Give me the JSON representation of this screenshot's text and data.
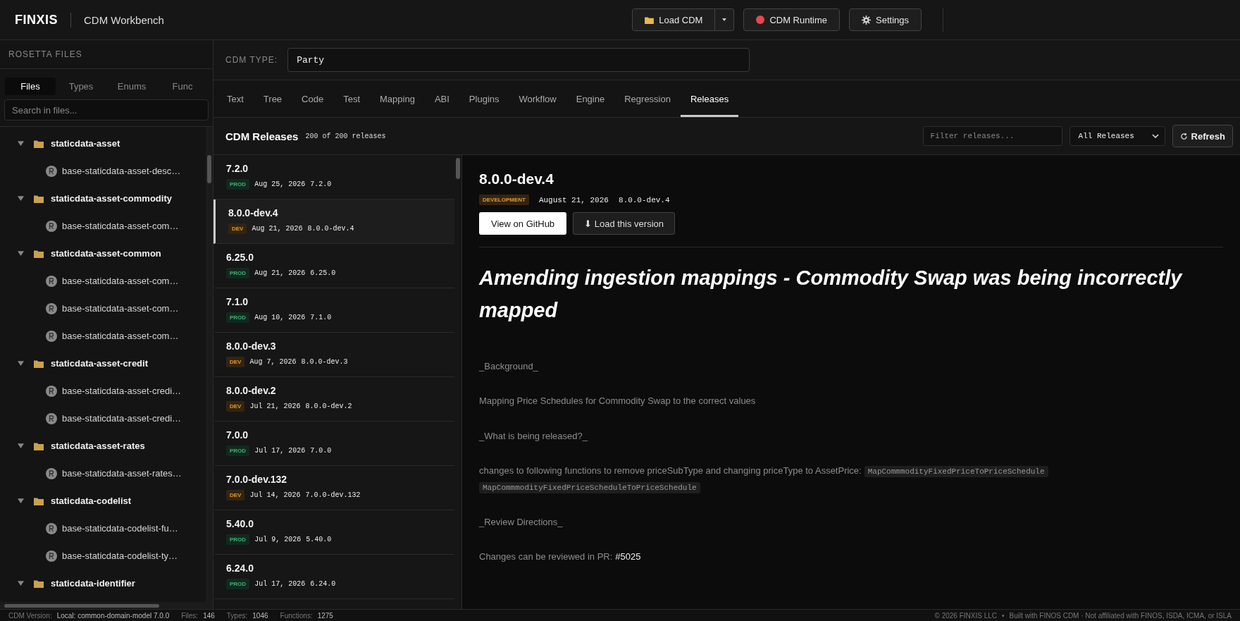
{
  "header": {
    "logo": "FINXIS",
    "app_title": "CDM Workbench",
    "buttons": [
      {
        "kind": "load",
        "label": "Load CDM"
      },
      {
        "kind": "runtime",
        "label": "CDM Runtime",
        "color": "#e5484d"
      },
      {
        "kind": "settings",
        "label": "Settings"
      }
    ]
  },
  "sidebar": {
    "title": "ROSETTA FILES",
    "tabs": [
      {
        "label": "Files",
        "selected": true
      },
      {
        "label": "Types",
        "selected": false
      },
      {
        "label": "Enums",
        "selected": false
      },
      {
        "label": "Func",
        "selected": false
      }
    ],
    "search": {
      "placeholder": "Search in files..."
    },
    "tree": [
      {
        "name": "staticdata-asset",
        "expanded": true,
        "children": [
          {
            "name": "base-staticdata-asset-desc…"
          }
        ]
      },
      {
        "name": "staticdata-asset-commodity",
        "expanded": true,
        "children": [
          {
            "name": "base-staticdata-asset-com…"
          }
        ]
      },
      {
        "name": "staticdata-asset-common",
        "expanded": true,
        "children": [
          {
            "name": "base-staticdata-asset-com…"
          },
          {
            "name": "base-staticdata-asset-com…"
          },
          {
            "name": "base-staticdata-asset-com…"
          }
        ]
      },
      {
        "name": "staticdata-asset-credit",
        "expanded": true,
        "children": [
          {
            "name": "base-staticdata-asset-credi…"
          },
          {
            "name": "base-staticdata-asset-credi…"
          }
        ]
      },
      {
        "name": "staticdata-asset-rates",
        "expanded": true,
        "children": [
          {
            "name": "base-staticdata-asset-rates…"
          }
        ]
      },
      {
        "name": "staticdata-codelist",
        "expanded": true,
        "children": [
          {
            "name": "base-staticdata-codelist-fu…"
          },
          {
            "name": "base-staticdata-codelist-ty…"
          }
        ]
      },
      {
        "name": "staticdata-identifier",
        "expanded": true
      }
    ]
  },
  "type_bar": {
    "label": "CDM TYPE:",
    "value": "Party"
  },
  "tabs": [
    {
      "label": "Text",
      "selected": false
    },
    {
      "label": "Tree",
      "selected": false
    },
    {
      "label": "Code",
      "selected": false
    },
    {
      "label": "Test",
      "selected": false
    },
    {
      "label": "Mapping",
      "selected": false
    },
    {
      "label": "ABI",
      "selected": false
    },
    {
      "label": "Plugins",
      "selected": false
    },
    {
      "label": "Workflow",
      "selected": false
    },
    {
      "label": "Engine",
      "selected": false
    },
    {
      "label": "Regression",
      "selected": false
    },
    {
      "label": "Releases",
      "selected": true
    }
  ],
  "releases": {
    "title": "CDM Releases",
    "count": "200 of 200 releases",
    "filter": {
      "placeholder": "Filter releases..."
    },
    "select": "All Releases",
    "refresh": "Refresh",
    "items": [
      {
        "version": "7.2.0",
        "kind": "prod",
        "badge": "PROD",
        "date": "Aug 25, 2026",
        "tag": "7.2.0",
        "selected": false
      },
      {
        "version": "8.0.0-dev.4",
        "kind": "dev",
        "badge": "DEV",
        "date": "Aug 21, 2026",
        "tag": "8.0.0-dev.4",
        "selected": true
      },
      {
        "version": "6.25.0",
        "kind": "prod",
        "badge": "PROD",
        "date": "Aug 21, 2026",
        "tag": "6.25.0",
        "selected": false
      },
      {
        "version": "7.1.0",
        "kind": "prod",
        "badge": "PROD",
        "date": "Aug 10, 2026",
        "tag": "7.1.0",
        "selected": false
      },
      {
        "version": "8.0.0-dev.3",
        "kind": "dev",
        "badge": "DEV",
        "date": "Aug 7, 2026",
        "tag": "8.0.0-dev.3",
        "selected": false
      },
      {
        "version": "8.0.0-dev.2",
        "kind": "dev",
        "badge": "DEV",
        "date": "Jul 21, 2026",
        "tag": "8.0.0-dev.2",
        "selected": false
      },
      {
        "version": "7.0.0",
        "kind": "prod",
        "badge": "PROD",
        "date": "Jul 17, 2026",
        "tag": "7.0.0",
        "selected": false
      },
      {
        "version": "7.0.0-dev.132",
        "kind": "dev",
        "badge": "DEV",
        "date": "Jul 14, 2026",
        "tag": "7.0.0-dev.132",
        "selected": false
      },
      {
        "version": "5.40.0",
        "kind": "prod",
        "badge": "PROD",
        "date": "Jul 9, 2026",
        "tag": "5.40.0",
        "selected": false
      },
      {
        "version": "6.24.0",
        "kind": "prod",
        "badge": "PROD",
        "date": "Jul 17, 2026",
        "tag": "6.24.0",
        "selected": false
      }
    ]
  },
  "detail": {
    "version": "8.0.0-dev.4",
    "kind": "dev",
    "badge": "DEVELOPMENT",
    "date": "August 21, 2026",
    "tag": "8.0.0-dev.4",
    "github_button": "View on GitHub",
    "load_button": "⬇ Load this version",
    "heading": "Amending ingestion mappings - Commodity Swap was being incorrectly mapped",
    "paragraphs": [
      [
        {
          "kind": "text",
          "text": "_Background_"
        }
      ],
      [
        {
          "kind": "text",
          "text": "Mapping Price Schedules for Commodity Swap to the correct values"
        }
      ],
      [
        {
          "kind": "text",
          "text": "_What is being released?_"
        }
      ],
      [
        {
          "kind": "text",
          "text": "changes to following functions to remove priceSubType and changing priceType to AssetPrice:"
        },
        {
          "kind": "code",
          "text": "MapCommmodityFixedPriceToPriceSchedule"
        },
        {
          "kind": "code",
          "text": "MapCommmodityFixedPriceScheduleToPriceSchedule"
        }
      ],
      [
        {
          "kind": "text",
          "text": "_Review Directions_"
        }
      ],
      [
        {
          "kind": "text",
          "text": "Changes can be reviewed in PR:"
        },
        {
          "kind": "link",
          "text": "#5025"
        }
      ]
    ]
  },
  "status_bar": {
    "left": [
      {
        "label": "CDM Version:",
        "value": "Local: common-domain-model 7.0.0"
      },
      {
        "label": "Files:",
        "value": "146"
      },
      {
        "label": "Types:",
        "value": "1046"
      },
      {
        "label": "Functions:",
        "value": "1275"
      }
    ],
    "copyright": "© 2026 FINXIS LLC",
    "separator": "•",
    "note": "Built with FINOS CDM · Not affiliated with FINOS, ISDA, ICMA, or ISLA"
  }
}
